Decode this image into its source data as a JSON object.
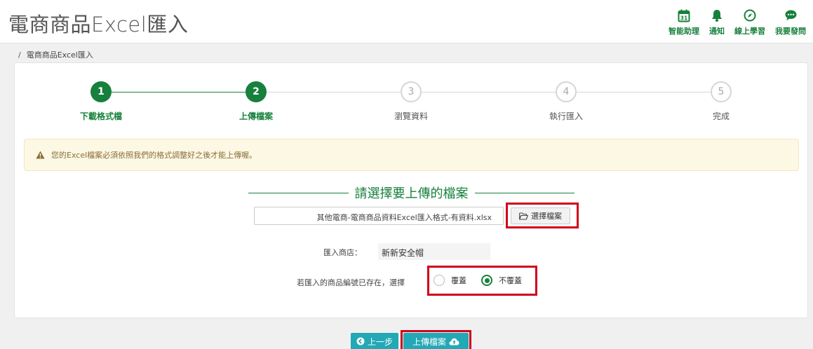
{
  "header": {
    "title": "電商商品Excel匯入",
    "actions": [
      {
        "label": "智能助理",
        "icon": "calendar-icon"
      },
      {
        "label": "通知",
        "icon": "bell-icon"
      },
      {
        "label": "線上學習",
        "icon": "compass-icon"
      },
      {
        "label": "我要發問",
        "icon": "chat-icon"
      }
    ],
    "calendar_day": "31"
  },
  "breadcrumb": {
    "separator": "/",
    "current": "電商商品Excel匯入"
  },
  "steps": [
    {
      "number": "1",
      "label": "下載格式檔",
      "done": true
    },
    {
      "number": "2",
      "label": "上傳檔案",
      "done": true
    },
    {
      "number": "3",
      "label": "瀏覽資料",
      "done": false
    },
    {
      "number": "4",
      "label": "執行匯入",
      "done": false
    },
    {
      "number": "5",
      "label": "完成",
      "done": false
    }
  ],
  "alert": {
    "text": "您的Excel檔案必須依照我們的格式調整好之後才能上傳喔。"
  },
  "upload": {
    "section_title": "請選擇要上傳的檔案",
    "file_name": "其他電商-電商商品資料Excel匯入格式-有資料.xlsx",
    "choose_label": "選擇檔案"
  },
  "store": {
    "label": "匯入商店：",
    "value": "新新安全帽"
  },
  "exists": {
    "label": "若匯入的商品編號已存在，選擇",
    "options": [
      {
        "label": "覆蓋",
        "selected": false
      },
      {
        "label": "不覆蓋",
        "selected": true
      }
    ]
  },
  "buttons": {
    "prev_label": "上一步",
    "upload_label": "上傳檔案"
  },
  "colors": {
    "brand_green": "#16803c",
    "button_teal": "#23a8b5",
    "highlight_red": "#d0021b",
    "alert_bg": "#fcf8e3"
  }
}
